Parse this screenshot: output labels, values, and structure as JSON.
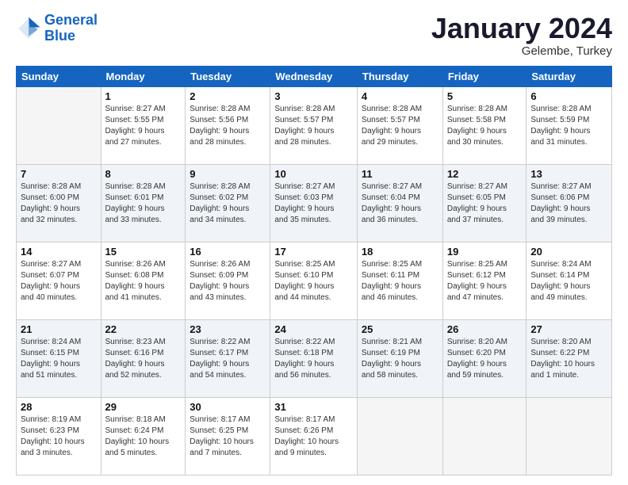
{
  "header": {
    "logo_line1": "General",
    "logo_line2": "Blue",
    "month_title": "January 2024",
    "subtitle": "Gelembe, Turkey"
  },
  "weekdays": [
    "Sunday",
    "Monday",
    "Tuesday",
    "Wednesday",
    "Thursday",
    "Friday",
    "Saturday"
  ],
  "weeks": [
    [
      {
        "day": "",
        "info": ""
      },
      {
        "day": "1",
        "info": "Sunrise: 8:27 AM\nSunset: 5:55 PM\nDaylight: 9 hours\nand 27 minutes."
      },
      {
        "day": "2",
        "info": "Sunrise: 8:28 AM\nSunset: 5:56 PM\nDaylight: 9 hours\nand 28 minutes."
      },
      {
        "day": "3",
        "info": "Sunrise: 8:28 AM\nSunset: 5:57 PM\nDaylight: 9 hours\nand 28 minutes."
      },
      {
        "day": "4",
        "info": "Sunrise: 8:28 AM\nSunset: 5:57 PM\nDaylight: 9 hours\nand 29 minutes."
      },
      {
        "day": "5",
        "info": "Sunrise: 8:28 AM\nSunset: 5:58 PM\nDaylight: 9 hours\nand 30 minutes."
      },
      {
        "day": "6",
        "info": "Sunrise: 8:28 AM\nSunset: 5:59 PM\nDaylight: 9 hours\nand 31 minutes."
      }
    ],
    [
      {
        "day": "7",
        "info": "Sunrise: 8:28 AM\nSunset: 6:00 PM\nDaylight: 9 hours\nand 32 minutes."
      },
      {
        "day": "8",
        "info": "Sunrise: 8:28 AM\nSunset: 6:01 PM\nDaylight: 9 hours\nand 33 minutes."
      },
      {
        "day": "9",
        "info": "Sunrise: 8:28 AM\nSunset: 6:02 PM\nDaylight: 9 hours\nand 34 minutes."
      },
      {
        "day": "10",
        "info": "Sunrise: 8:27 AM\nSunset: 6:03 PM\nDaylight: 9 hours\nand 35 minutes."
      },
      {
        "day": "11",
        "info": "Sunrise: 8:27 AM\nSunset: 6:04 PM\nDaylight: 9 hours\nand 36 minutes."
      },
      {
        "day": "12",
        "info": "Sunrise: 8:27 AM\nSunset: 6:05 PM\nDaylight: 9 hours\nand 37 minutes."
      },
      {
        "day": "13",
        "info": "Sunrise: 8:27 AM\nSunset: 6:06 PM\nDaylight: 9 hours\nand 39 minutes."
      }
    ],
    [
      {
        "day": "14",
        "info": "Sunrise: 8:27 AM\nSunset: 6:07 PM\nDaylight: 9 hours\nand 40 minutes."
      },
      {
        "day": "15",
        "info": "Sunrise: 8:26 AM\nSunset: 6:08 PM\nDaylight: 9 hours\nand 41 minutes."
      },
      {
        "day": "16",
        "info": "Sunrise: 8:26 AM\nSunset: 6:09 PM\nDaylight: 9 hours\nand 43 minutes."
      },
      {
        "day": "17",
        "info": "Sunrise: 8:25 AM\nSunset: 6:10 PM\nDaylight: 9 hours\nand 44 minutes."
      },
      {
        "day": "18",
        "info": "Sunrise: 8:25 AM\nSunset: 6:11 PM\nDaylight: 9 hours\nand 46 minutes."
      },
      {
        "day": "19",
        "info": "Sunrise: 8:25 AM\nSunset: 6:12 PM\nDaylight: 9 hours\nand 47 minutes."
      },
      {
        "day": "20",
        "info": "Sunrise: 8:24 AM\nSunset: 6:14 PM\nDaylight: 9 hours\nand 49 minutes."
      }
    ],
    [
      {
        "day": "21",
        "info": "Sunrise: 8:24 AM\nSunset: 6:15 PM\nDaylight: 9 hours\nand 51 minutes."
      },
      {
        "day": "22",
        "info": "Sunrise: 8:23 AM\nSunset: 6:16 PM\nDaylight: 9 hours\nand 52 minutes."
      },
      {
        "day": "23",
        "info": "Sunrise: 8:22 AM\nSunset: 6:17 PM\nDaylight: 9 hours\nand 54 minutes."
      },
      {
        "day": "24",
        "info": "Sunrise: 8:22 AM\nSunset: 6:18 PM\nDaylight: 9 hours\nand 56 minutes."
      },
      {
        "day": "25",
        "info": "Sunrise: 8:21 AM\nSunset: 6:19 PM\nDaylight: 9 hours\nand 58 minutes."
      },
      {
        "day": "26",
        "info": "Sunrise: 8:20 AM\nSunset: 6:20 PM\nDaylight: 9 hours\nand 59 minutes."
      },
      {
        "day": "27",
        "info": "Sunrise: 8:20 AM\nSunset: 6:22 PM\nDaylight: 10 hours\nand 1 minute."
      }
    ],
    [
      {
        "day": "28",
        "info": "Sunrise: 8:19 AM\nSunset: 6:23 PM\nDaylight: 10 hours\nand 3 minutes."
      },
      {
        "day": "29",
        "info": "Sunrise: 8:18 AM\nSunset: 6:24 PM\nDaylight: 10 hours\nand 5 minutes."
      },
      {
        "day": "30",
        "info": "Sunrise: 8:17 AM\nSunset: 6:25 PM\nDaylight: 10 hours\nand 7 minutes."
      },
      {
        "day": "31",
        "info": "Sunrise: 8:17 AM\nSunset: 6:26 PM\nDaylight: 10 hours\nand 9 minutes."
      },
      {
        "day": "",
        "info": ""
      },
      {
        "day": "",
        "info": ""
      },
      {
        "day": "",
        "info": ""
      }
    ]
  ]
}
